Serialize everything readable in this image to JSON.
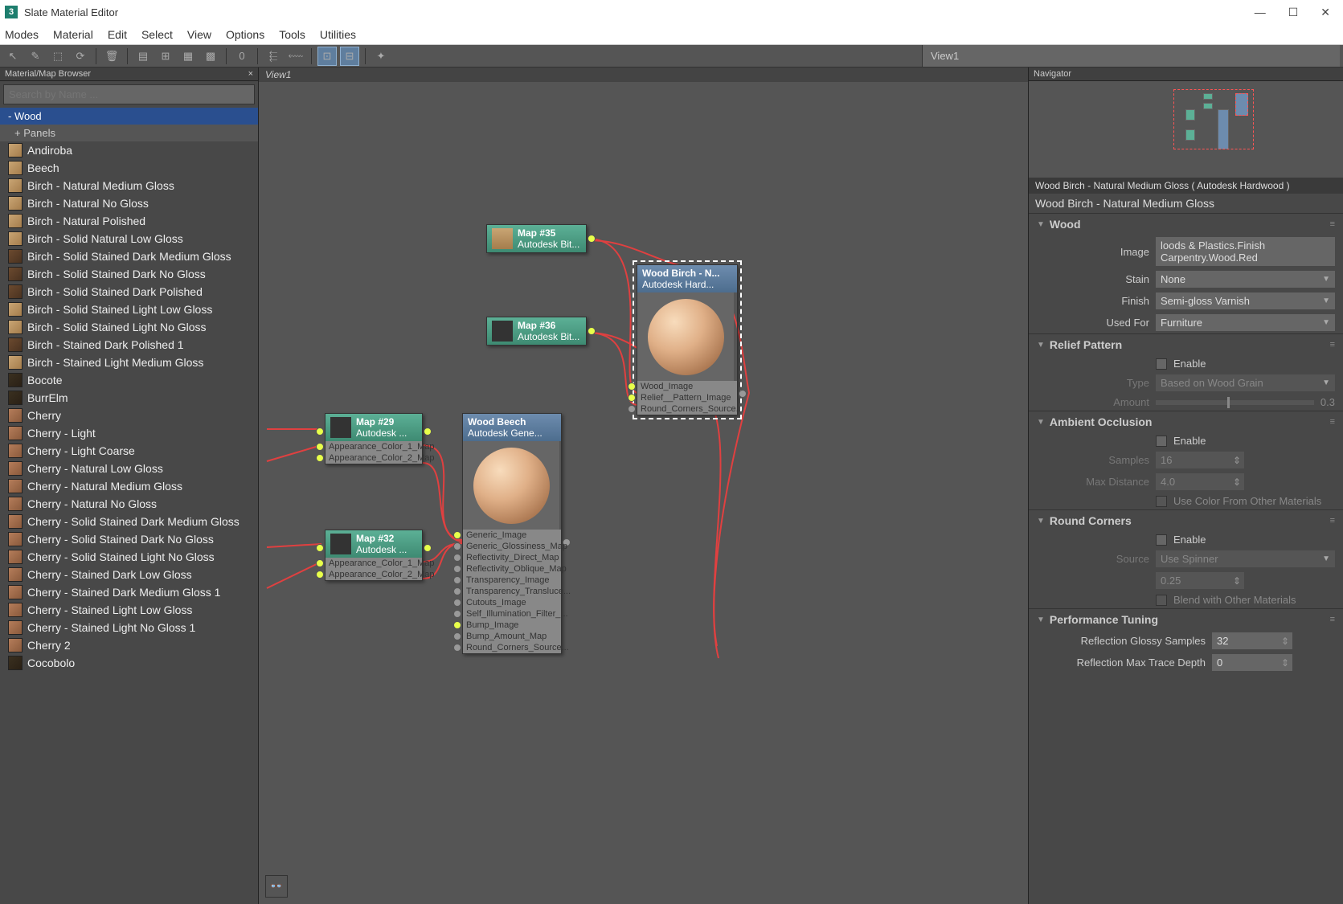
{
  "title": "Slate Material Editor",
  "menu": [
    "Modes",
    "Material",
    "Edit",
    "Select",
    "View",
    "Options",
    "Tools",
    "Utilities"
  ],
  "view_tab": "View1",
  "browser": {
    "header": "Material/Map Browser",
    "search_placeholder": "Search by Name ...",
    "category": "- Wood",
    "subcategory": "+ Panels",
    "items": [
      "Andiroba",
      "Beech",
      "Birch - Natural Medium Gloss",
      "Birch - Natural No Gloss",
      "Birch - Natural Polished",
      "Birch - Solid Natural Low Gloss",
      "Birch - Solid Stained Dark Medium Gloss",
      "Birch - Solid Stained Dark No Gloss",
      "Birch - Solid Stained Dark Polished",
      "Birch - Solid Stained Light Low Gloss",
      "Birch - Solid Stained Light No Gloss",
      "Birch - Stained Dark Polished 1",
      "Birch - Stained Light Medium Gloss",
      "Bocote",
      "BurrElm",
      "Cherry",
      "Cherry - Light",
      "Cherry - Light Coarse",
      "Cherry - Natural Low Gloss",
      "Cherry - Natural Medium Gloss",
      "Cherry - Natural No Gloss",
      "Cherry - Solid Stained Dark Medium Gloss",
      "Cherry - Solid Stained Dark No Gloss",
      "Cherry - Solid Stained Light No Gloss",
      "Cherry - Stained Dark Low Gloss",
      "Cherry - Stained Dark Medium Gloss 1",
      "Cherry - Stained Light Low Gloss",
      "Cherry - Stained Light No Gloss 1",
      "Cherry 2",
      "Cocobolo"
    ]
  },
  "canvas": {
    "header": "View1",
    "nodes": {
      "map35": {
        "title": "Map #35",
        "sub": "Autodesk Bit..."
      },
      "map36": {
        "title": "Map #36",
        "sub": "Autodesk Bit..."
      },
      "map29": {
        "title": "Map #29",
        "sub": "Autodesk ...",
        "slots": [
          "Appearance_Color_1_Map",
          "Appearance_Color_2_Map"
        ]
      },
      "map32": {
        "title": "Map #32",
        "sub": "Autodesk ...",
        "slots": [
          "Appearance_Color_1_Map",
          "Appearance_Color_2_Map"
        ]
      },
      "beech": {
        "title": "Wood Beech",
        "sub": "Autodesk Gene...",
        "slots": [
          "Generic_Image",
          "Generic_Glossiness_Map",
          "Reflectivity_Direct_Map",
          "Reflectivity_Oblique_Map",
          "Transparency_Image",
          "Transparency_Transluce...",
          "Cutouts_Image",
          "Self_Illumination_Filter_...",
          "Bump_Image",
          "Bump_Amount_Map",
          "Round_Corners_Source..."
        ]
      },
      "birch": {
        "title": "Wood Birch - N...",
        "sub": "Autodesk Hard...",
        "slots": [
          "Wood_Image",
          "Relief__Pattern_Image",
          "Round_Corners_Source..."
        ]
      }
    }
  },
  "navigator": {
    "header": "Navigator"
  },
  "params": {
    "header": "Wood Birch - Natural Medium Gloss  ( Autodesk Hardwood )",
    "title": "Wood Birch - Natural Medium Gloss",
    "wood": {
      "label": "Wood",
      "image_label": "Image",
      "image_val": "loods & Plastics.Finish Carpentry.Wood.Red",
      "stain_label": "Stain",
      "stain_val": "None",
      "finish_label": "Finish",
      "finish_val": "Semi-gloss Varnish",
      "used_label": "Used For",
      "used_val": "Furniture"
    },
    "relief": {
      "label": "Relief  Pattern",
      "enable": "Enable",
      "type_label": "Type",
      "type_val": "Based on Wood Grain",
      "amount_label": "Amount",
      "amount_val": "0.3"
    },
    "ao": {
      "label": "Ambient Occlusion",
      "enable": "Enable",
      "samples_label": "Samples",
      "samples_val": "16",
      "dist_label": "Max Distance",
      "dist_val": "4.0",
      "usecolor": "Use Color From Other Materials"
    },
    "corners": {
      "label": "Round Corners",
      "enable": "Enable",
      "source_label": "Source",
      "source_val": "Use Spinner",
      "radius_val": "0.25",
      "blend": "Blend with Other Materials"
    },
    "perf": {
      "label": "Performance Tuning",
      "glossy_label": "Reflection Glossy Samples",
      "glossy_val": "32",
      "depth_label": "Reflection Max Trace Depth",
      "depth_val": "0"
    }
  }
}
